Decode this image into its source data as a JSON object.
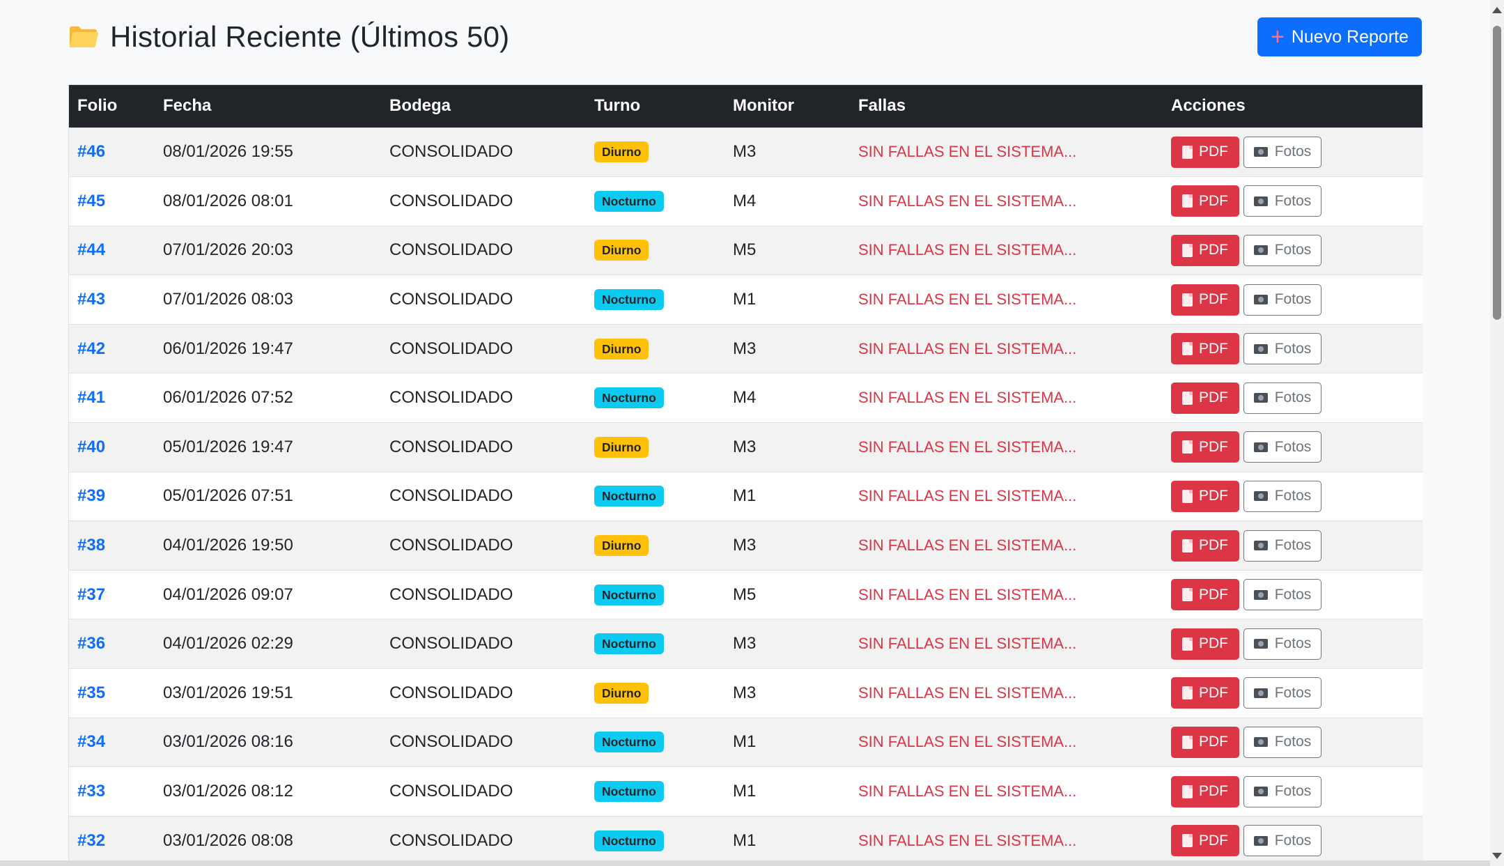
{
  "header": {
    "title": "Historial Reciente (Últimos 50)",
    "title_icon": "folder-icon",
    "new_button_label": "Nuevo Reporte",
    "new_button_icon": "plus-icon"
  },
  "table": {
    "columns": [
      "Folio",
      "Fecha",
      "Bodega",
      "Turno",
      "Monitor",
      "Fallas",
      "Acciones"
    ],
    "pdf_label": "PDF",
    "fotos_label": "Fotos",
    "rows": [
      {
        "folio": "#46",
        "fecha": "08/01/2026 19:55",
        "bodega": "CONSOLIDADO",
        "turno": "Diurno",
        "monitor": "M3",
        "fallas": "SIN FALLAS EN EL SISTEMA..."
      },
      {
        "folio": "#45",
        "fecha": "08/01/2026 08:01",
        "bodega": "CONSOLIDADO",
        "turno": "Nocturno",
        "monitor": "M4",
        "fallas": "SIN FALLAS EN EL SISTEMA..."
      },
      {
        "folio": "#44",
        "fecha": "07/01/2026 20:03",
        "bodega": "CONSOLIDADO",
        "turno": "Diurno",
        "monitor": "M5",
        "fallas": "SIN FALLAS EN EL SISTEMA..."
      },
      {
        "folio": "#43",
        "fecha": "07/01/2026 08:03",
        "bodega": "CONSOLIDADO",
        "turno": "Nocturno",
        "monitor": "M1",
        "fallas": "SIN FALLAS EN EL SISTEMA..."
      },
      {
        "folio": "#42",
        "fecha": "06/01/2026 19:47",
        "bodega": "CONSOLIDADO",
        "turno": "Diurno",
        "monitor": "M3",
        "fallas": "SIN FALLAS EN EL SISTEMA..."
      },
      {
        "folio": "#41",
        "fecha": "06/01/2026 07:52",
        "bodega": "CONSOLIDADO",
        "turno": "Nocturno",
        "monitor": "M4",
        "fallas": "SIN FALLAS EN EL SISTEMA..."
      },
      {
        "folio": "#40",
        "fecha": "05/01/2026 19:47",
        "bodega": "CONSOLIDADO",
        "turno": "Diurno",
        "monitor": "M3",
        "fallas": "SIN FALLAS EN EL SISTEMA..."
      },
      {
        "folio": "#39",
        "fecha": "05/01/2026 07:51",
        "bodega": "CONSOLIDADO",
        "turno": "Nocturno",
        "monitor": "M1",
        "fallas": "SIN FALLAS EN EL SISTEMA..."
      },
      {
        "folio": "#38",
        "fecha": "04/01/2026 19:50",
        "bodega": "CONSOLIDADO",
        "turno": "Diurno",
        "monitor": "M3",
        "fallas": "SIN FALLAS EN EL SISTEMA..."
      },
      {
        "folio": "#37",
        "fecha": "04/01/2026 09:07",
        "bodega": "CONSOLIDADO",
        "turno": "Nocturno",
        "monitor": "M5",
        "fallas": "SIN FALLAS EN EL SISTEMA..."
      },
      {
        "folio": "#36",
        "fecha": "04/01/2026 02:29",
        "bodega": "CONSOLIDADO",
        "turno": "Nocturno",
        "monitor": "M3",
        "fallas": "SIN FALLAS EN EL SISTEMA..."
      },
      {
        "folio": "#35",
        "fecha": "03/01/2026 19:51",
        "bodega": "CONSOLIDADO",
        "turno": "Diurno",
        "monitor": "M3",
        "fallas": "SIN FALLAS EN EL SISTEMA..."
      },
      {
        "folio": "#34",
        "fecha": "03/01/2026 08:16",
        "bodega": "CONSOLIDADO",
        "turno": "Nocturno",
        "monitor": "M1",
        "fallas": "SIN FALLAS EN EL SISTEMA..."
      },
      {
        "folio": "#33",
        "fecha": "03/01/2026 08:12",
        "bodega": "CONSOLIDADO",
        "turno": "Nocturno",
        "monitor": "M1",
        "fallas": "SIN FALLAS EN EL SISTEMA..."
      },
      {
        "folio": "#32",
        "fecha": "03/01/2026 08:08",
        "bodega": "CONSOLIDADO",
        "turno": "Nocturno",
        "monitor": "M1",
        "fallas": "SIN FALLAS EN EL SISTEMA..."
      }
    ]
  },
  "colors": {
    "primary": "#0d6efd",
    "danger": "#dc3545",
    "secondary": "#6c757d",
    "badge_diurno": "#ffc107",
    "badge_nocturno": "#0dcaf0",
    "table_header": "#212529"
  },
  "icons": {
    "pdf_button_icon": "document-icon",
    "fotos_button_icon": "camera-icon"
  }
}
